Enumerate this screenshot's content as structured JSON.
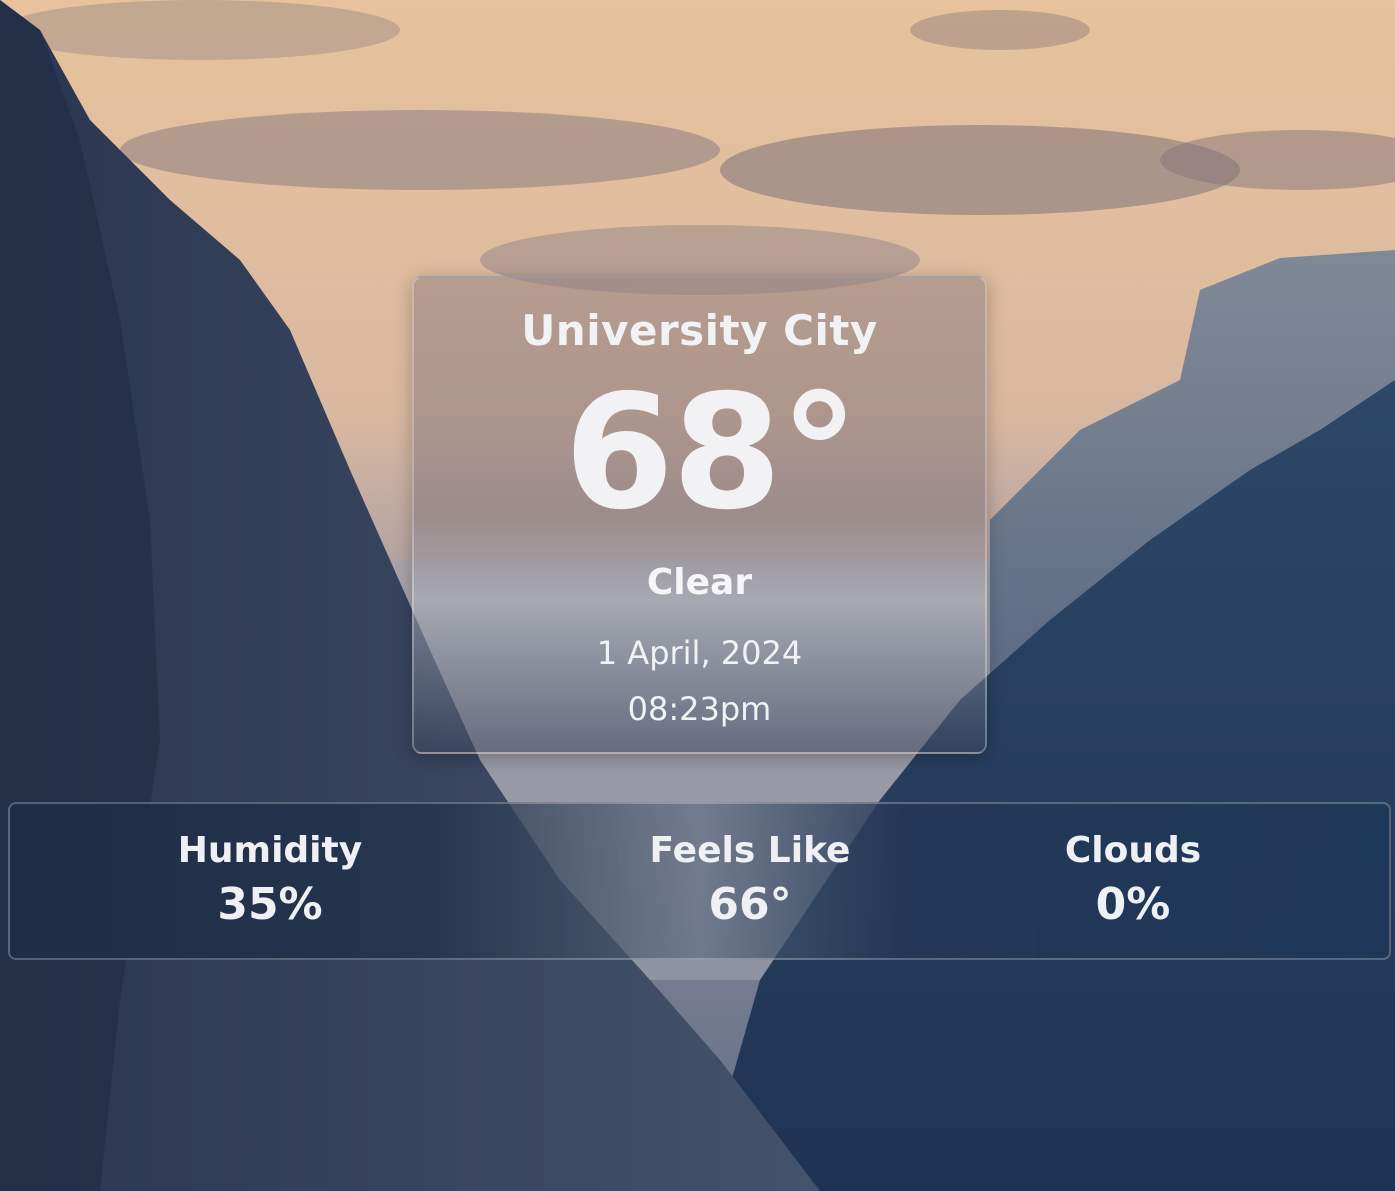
{
  "weather": {
    "city": "University City",
    "temperature": "68°",
    "condition": "Clear",
    "date": "1 April, 2024",
    "time": "08:23pm"
  },
  "stats": [
    {
      "label": "Humidity",
      "value": "35%"
    },
    {
      "label": "Feels Like",
      "value": "66°"
    },
    {
      "label": "Clouds",
      "value": "0%"
    }
  ],
  "background": {
    "subject": "mountain-valley-at-dusk",
    "sky_color": "#e9c9a3",
    "mountain_color": "#2e4262"
  }
}
